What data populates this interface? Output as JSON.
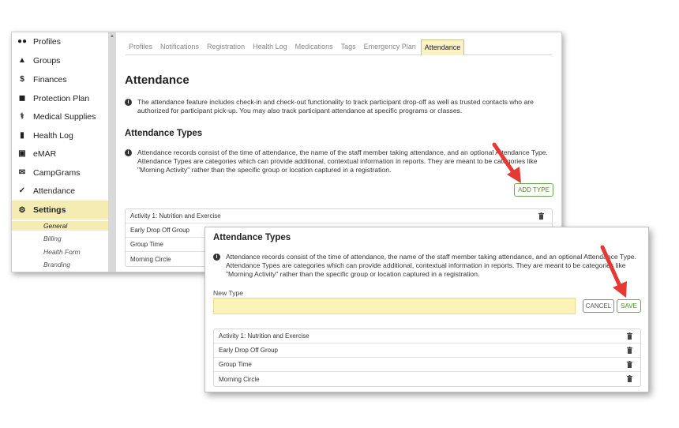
{
  "sidebar": {
    "items": [
      {
        "label": "Profiles",
        "icon": "users-icon"
      },
      {
        "label": "Groups",
        "icon": "sitemap-icon"
      },
      {
        "label": "Finances",
        "icon": "dollar-icon"
      },
      {
        "label": "Protection Plan",
        "icon": "shield-icon"
      },
      {
        "label": "Medical Supplies",
        "icon": "medical-icon"
      },
      {
        "label": "Health Log",
        "icon": "book-icon"
      },
      {
        "label": "eMAR",
        "icon": "medkit-icon"
      },
      {
        "label": "CampGrams",
        "icon": "envelope-icon"
      },
      {
        "label": "Attendance",
        "icon": "check-circle-icon"
      },
      {
        "label": "Settings",
        "icon": "gear-icon"
      }
    ],
    "sub_items": [
      "General",
      "Billing",
      "Health Form",
      "Branding"
    ]
  },
  "tabs": [
    "Profiles",
    "Notifications",
    "Registration",
    "Health Log",
    "Medications",
    "Tags",
    "Emergency Plan",
    "Attendance"
  ],
  "main": {
    "title": "Attendance",
    "intro": "The attendance feature includes check-in and check-out functionality to track participant drop-off as well as trusted contacts who are authorized for participant pick-up. You may also track participant attendance at specific programs or classes.",
    "types_heading": "Attendance Types",
    "types_info": "Attendance records consist of the time of attendance, the name of the staff member taking attendance, and an optional Attendance Type. Attendance Types are categories which can provide additional, contextual information in reports. They are meant to be categories like \"Morning Activity\" rather than the specific group or location captured in a registration.",
    "add_type_label": "ADD TYPE",
    "list": [
      "Activity 1: Nutrition and Exercise",
      "Early Drop Off Group",
      "Group Time",
      "Morning Circle"
    ]
  },
  "popup": {
    "title": "Attendance Types",
    "info": "Attendance records consist of the time of attendance, the name of the staff member taking attendance, and an optional Attendance Type. Attendance Types are categories which can provide additional, contextual information in reports. They are meant to be categories like \"Morning Activity\" rather than the specific group or location captured in a registration.",
    "new_type_label": "New Type",
    "new_type_value": "",
    "cancel_label": "CANCEL",
    "save_label": "SAVE",
    "list": [
      "Activity 1: Nutrition and Exercise",
      "Early Drop Off Group",
      "Group Time",
      "Morning Circle"
    ]
  },
  "colors": {
    "active_bg": "#f4ecb2",
    "button_green": "#6aa84f",
    "arrow_red": "#e53935"
  }
}
